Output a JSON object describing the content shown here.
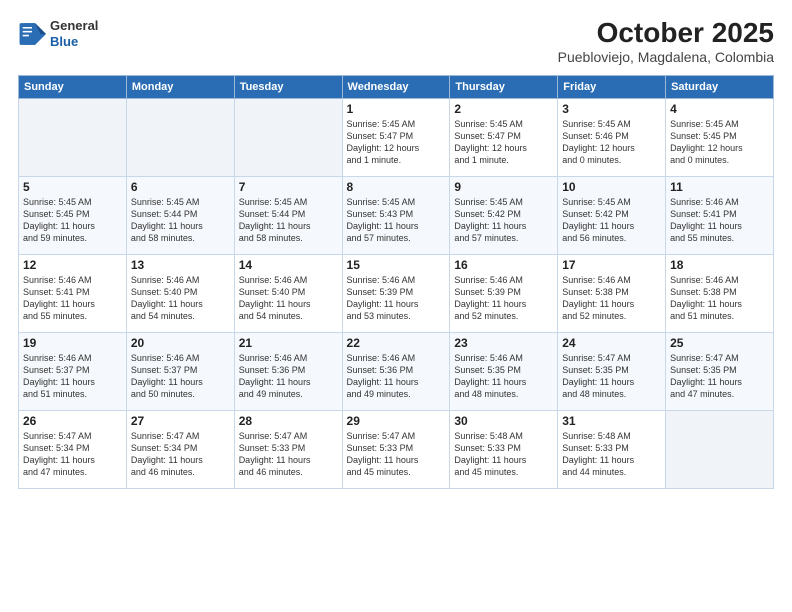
{
  "header": {
    "logo_general": "General",
    "logo_blue": "Blue",
    "month_year": "October 2025",
    "location": "Puebloviejo, Magdalena, Colombia"
  },
  "weekdays": [
    "Sunday",
    "Monday",
    "Tuesday",
    "Wednesday",
    "Thursday",
    "Friday",
    "Saturday"
  ],
  "weeks": [
    [
      {
        "day": "",
        "info": ""
      },
      {
        "day": "",
        "info": ""
      },
      {
        "day": "",
        "info": ""
      },
      {
        "day": "1",
        "info": "Sunrise: 5:45 AM\nSunset: 5:47 PM\nDaylight: 12 hours\nand 1 minute."
      },
      {
        "day": "2",
        "info": "Sunrise: 5:45 AM\nSunset: 5:47 PM\nDaylight: 12 hours\nand 1 minute."
      },
      {
        "day": "3",
        "info": "Sunrise: 5:45 AM\nSunset: 5:46 PM\nDaylight: 12 hours\nand 0 minutes."
      },
      {
        "day": "4",
        "info": "Sunrise: 5:45 AM\nSunset: 5:45 PM\nDaylight: 12 hours\nand 0 minutes."
      }
    ],
    [
      {
        "day": "5",
        "info": "Sunrise: 5:45 AM\nSunset: 5:45 PM\nDaylight: 11 hours\nand 59 minutes."
      },
      {
        "day": "6",
        "info": "Sunrise: 5:45 AM\nSunset: 5:44 PM\nDaylight: 11 hours\nand 58 minutes."
      },
      {
        "day": "7",
        "info": "Sunrise: 5:45 AM\nSunset: 5:44 PM\nDaylight: 11 hours\nand 58 minutes."
      },
      {
        "day": "8",
        "info": "Sunrise: 5:45 AM\nSunset: 5:43 PM\nDaylight: 11 hours\nand 57 minutes."
      },
      {
        "day": "9",
        "info": "Sunrise: 5:45 AM\nSunset: 5:42 PM\nDaylight: 11 hours\nand 57 minutes."
      },
      {
        "day": "10",
        "info": "Sunrise: 5:45 AM\nSunset: 5:42 PM\nDaylight: 11 hours\nand 56 minutes."
      },
      {
        "day": "11",
        "info": "Sunrise: 5:46 AM\nSunset: 5:41 PM\nDaylight: 11 hours\nand 55 minutes."
      }
    ],
    [
      {
        "day": "12",
        "info": "Sunrise: 5:46 AM\nSunset: 5:41 PM\nDaylight: 11 hours\nand 55 minutes."
      },
      {
        "day": "13",
        "info": "Sunrise: 5:46 AM\nSunset: 5:40 PM\nDaylight: 11 hours\nand 54 minutes."
      },
      {
        "day": "14",
        "info": "Sunrise: 5:46 AM\nSunset: 5:40 PM\nDaylight: 11 hours\nand 54 minutes."
      },
      {
        "day": "15",
        "info": "Sunrise: 5:46 AM\nSunset: 5:39 PM\nDaylight: 11 hours\nand 53 minutes."
      },
      {
        "day": "16",
        "info": "Sunrise: 5:46 AM\nSunset: 5:39 PM\nDaylight: 11 hours\nand 52 minutes."
      },
      {
        "day": "17",
        "info": "Sunrise: 5:46 AM\nSunset: 5:38 PM\nDaylight: 11 hours\nand 52 minutes."
      },
      {
        "day": "18",
        "info": "Sunrise: 5:46 AM\nSunset: 5:38 PM\nDaylight: 11 hours\nand 51 minutes."
      }
    ],
    [
      {
        "day": "19",
        "info": "Sunrise: 5:46 AM\nSunset: 5:37 PM\nDaylight: 11 hours\nand 51 minutes."
      },
      {
        "day": "20",
        "info": "Sunrise: 5:46 AM\nSunset: 5:37 PM\nDaylight: 11 hours\nand 50 minutes."
      },
      {
        "day": "21",
        "info": "Sunrise: 5:46 AM\nSunset: 5:36 PM\nDaylight: 11 hours\nand 49 minutes."
      },
      {
        "day": "22",
        "info": "Sunrise: 5:46 AM\nSunset: 5:36 PM\nDaylight: 11 hours\nand 49 minutes."
      },
      {
        "day": "23",
        "info": "Sunrise: 5:46 AM\nSunset: 5:35 PM\nDaylight: 11 hours\nand 48 minutes."
      },
      {
        "day": "24",
        "info": "Sunrise: 5:47 AM\nSunset: 5:35 PM\nDaylight: 11 hours\nand 48 minutes."
      },
      {
        "day": "25",
        "info": "Sunrise: 5:47 AM\nSunset: 5:35 PM\nDaylight: 11 hours\nand 47 minutes."
      }
    ],
    [
      {
        "day": "26",
        "info": "Sunrise: 5:47 AM\nSunset: 5:34 PM\nDaylight: 11 hours\nand 47 minutes."
      },
      {
        "day": "27",
        "info": "Sunrise: 5:47 AM\nSunset: 5:34 PM\nDaylight: 11 hours\nand 46 minutes."
      },
      {
        "day": "28",
        "info": "Sunrise: 5:47 AM\nSunset: 5:33 PM\nDaylight: 11 hours\nand 46 minutes."
      },
      {
        "day": "29",
        "info": "Sunrise: 5:47 AM\nSunset: 5:33 PM\nDaylight: 11 hours\nand 45 minutes."
      },
      {
        "day": "30",
        "info": "Sunrise: 5:48 AM\nSunset: 5:33 PM\nDaylight: 11 hours\nand 45 minutes."
      },
      {
        "day": "31",
        "info": "Sunrise: 5:48 AM\nSunset: 5:33 PM\nDaylight: 11 hours\nand 44 minutes."
      },
      {
        "day": "",
        "info": ""
      }
    ]
  ]
}
